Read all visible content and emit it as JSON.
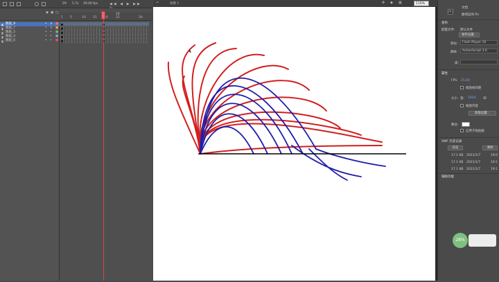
{
  "timeline": {
    "ruler_numbers": [
      "1",
      "5",
      "10",
      "15",
      "20",
      "25",
      "30"
    ],
    "current_frame_marker": "18",
    "fps_readout": "29",
    "fps_value": "5.7s",
    "zoom_readout": "29.00 fps",
    "layers": [
      {
        "name": "图层_9",
        "selected": true
      },
      {
        "name": "图层_7",
        "selected": false
      },
      {
        "name": "图层_5",
        "selected": false
      },
      {
        "name": "图层_4",
        "selected": false
      },
      {
        "name": "图层_6",
        "selected": false
      }
    ]
  },
  "stage": {
    "scene_label": "场景 1",
    "zoom": "110%"
  },
  "properties": {
    "doc_label": "文档",
    "doc_name": "曲线运动.fla",
    "publish_title": "发布",
    "profile_label": "配置文件:",
    "profile_value": "默认文件",
    "publish_settings_button": "发布设置...",
    "target_label": "目标:",
    "target_value": "Flash Player 10",
    "script_label": "脚本:",
    "script_value": "ActionScript 3.0",
    "class_label": "类:",
    "props_title": "属性",
    "fps_label": "FPS:",
    "fps_value": "25.00",
    "scale_label": "缩放帧间距",
    "size_label": "大小:",
    "size_w_label": "宽:",
    "size_w_value": "1920",
    "scale_content_label": "缩放内容",
    "advanced_button": "高级设置...",
    "stage_label": "舞台:",
    "apply_board_label": "应用于粘贴板",
    "swf_title": "SWF 历史记录",
    "log_button": "日志",
    "clear_button": "清除",
    "history": [
      {
        "size": "17.1 KB",
        "date": "2021/1/7",
        "time": "19:0"
      },
      {
        "size": "17.1 KB",
        "date": "2021/1/7",
        "time": "19:1"
      },
      {
        "size": "17.1 KB",
        "date": "2021/1/7",
        "time": "19:1"
      }
    ],
    "accessibility_label": "辅助功能",
    "badge_value": "28%"
  },
  "colors": {
    "red_curve": "#d21e1e",
    "blue_curve": "#1e1eaa",
    "selected_layer": "#4a73b8"
  }
}
